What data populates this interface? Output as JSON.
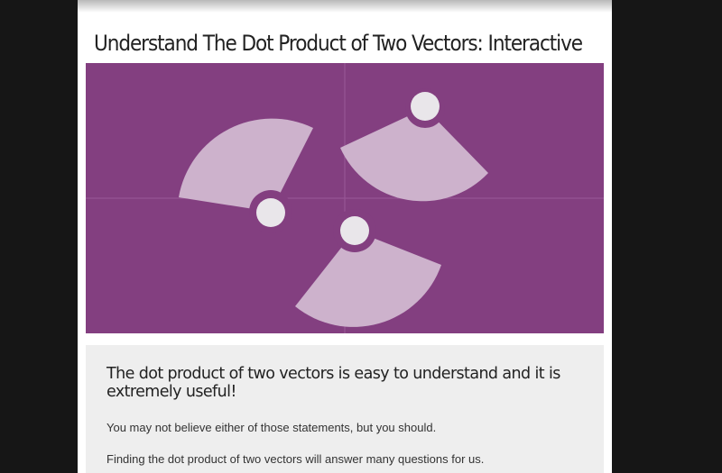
{
  "page": {
    "title": "Understand The Dot Product of Two Vectors: Interactive"
  },
  "hero": {
    "icon": "rotating-vectors-illustration",
    "colors": {
      "background": "#833f80",
      "sector": "#cdb2cc",
      "handle": "#e9e6ea",
      "grid": "#9a5897"
    }
  },
  "content": {
    "heading": "The dot product of two vectors is easy to understand and it is extremely useful!",
    "paragraphs": [
      "You may not believe either of those statements, but you should.",
      "Finding the dot product of two vectors will answer many questions for us."
    ]
  },
  "colors": {
    "backdrop": "#161616",
    "page": "#ffffff",
    "card": "#eeeeee",
    "text": "#222222"
  }
}
